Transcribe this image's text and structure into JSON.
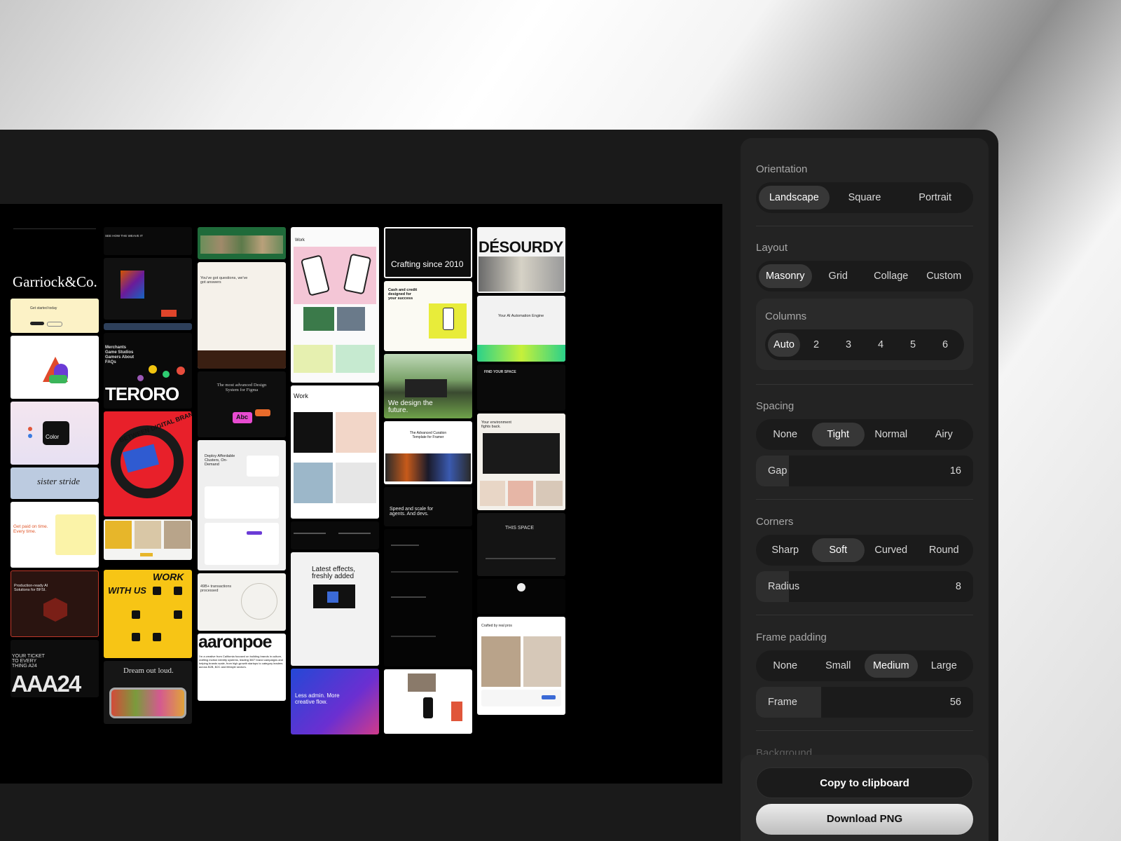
{
  "settings": {
    "orientation": {
      "label": "Orientation",
      "options": [
        "Landscape",
        "Square",
        "Portrait"
      ],
      "selected": "Landscape"
    },
    "layout": {
      "label": "Layout",
      "options": [
        "Masonry",
        "Grid",
        "Collage",
        "Custom"
      ],
      "selected": "Masonry"
    },
    "columns": {
      "label": "Columns",
      "options": [
        "Auto",
        "2",
        "3",
        "4",
        "5",
        "6"
      ],
      "selected": "Auto"
    },
    "spacing": {
      "label": "Spacing",
      "options": [
        "None",
        "Tight",
        "Normal",
        "Airy"
      ],
      "selected": "Tight",
      "gap_label": "Gap",
      "gap_value": "16",
      "gap_fraction": 0.15
    },
    "corners": {
      "label": "Corners",
      "options": [
        "Sharp",
        "Soft",
        "Curved",
        "Round"
      ],
      "selected": "Soft",
      "radius_label": "Radius",
      "radius_value": "8",
      "radius_fraction": 0.15
    },
    "frame_padding": {
      "label": "Frame padding",
      "options": [
        "None",
        "Small",
        "Medium",
        "Large"
      ],
      "selected": "Medium",
      "frame_label": "Frame",
      "frame_value": "56",
      "frame_fraction": 0.3
    },
    "background": {
      "label": "Background"
    }
  },
  "actions": {
    "copy_label": "Copy to clipboard",
    "download_label": "Download PNG"
  },
  "thumbnails": {
    "garriock": "Garriock&Co.",
    "get_started": "Get started today",
    "color": "Color",
    "sister_stride": "sister stride",
    "get_paid": "Get paid on time. Every time.",
    "production_ready": "Production-ready AI Solutions for BFSI.",
    "your_ticket": "YOUR TICKET TO EVERY THING A24",
    "a24": "AAA24",
    "see_how": "SEE HOW THE WEAVE IT",
    "merchants": "Merchants Game Studios Gamers About FAQs",
    "teroro": "TERORO",
    "between_digital": "BETWEEN DIGITAL BRAND DESIGN",
    "with_us": "WITH US",
    "work_big": "WORK",
    "dream_out_loud": "Dream out loud.",
    "questions": "You've got questions, we've got answers",
    "advanced_design_system": "The most advanced Design System for Figma",
    "abc": "Abc",
    "deploy_clusters": "Deploy Affordable Clusters, On-Demand",
    "transactions": "49B+ transactions processed",
    "aaronpoe": "aaronpoe",
    "aaronpoe_bio": "I'm a creative from California focused on building brands in culture, crafting motion identity systems, leading 360° brand campaigns and helping brands scale, from high-growth startups to category leaders across B2B, B2C and lifestyle sectors.",
    "work_1": "Work",
    "work_2": "Work",
    "latest_effects": "Latest effects, freshly added",
    "less_admin": "Less admin. More creative flow.",
    "crafting_since": "Crafting since 2010",
    "cash_credit": "Cash and credit designed for your success",
    "we_design": "We design the future.",
    "advanced_curation": "The Advanced Curation Template for Framer",
    "speed_scale": "Speed and scale for agents. And devs.",
    "desourdy": "DÉSOURDY",
    "ai_automation": "Your AI Automation Engine",
    "find_your_space": "FIND YOUR SPACE",
    "environment": "Your environment fights back.",
    "this_space": "THIS SPACE",
    "crafted_by": "Crafted by real pros"
  }
}
